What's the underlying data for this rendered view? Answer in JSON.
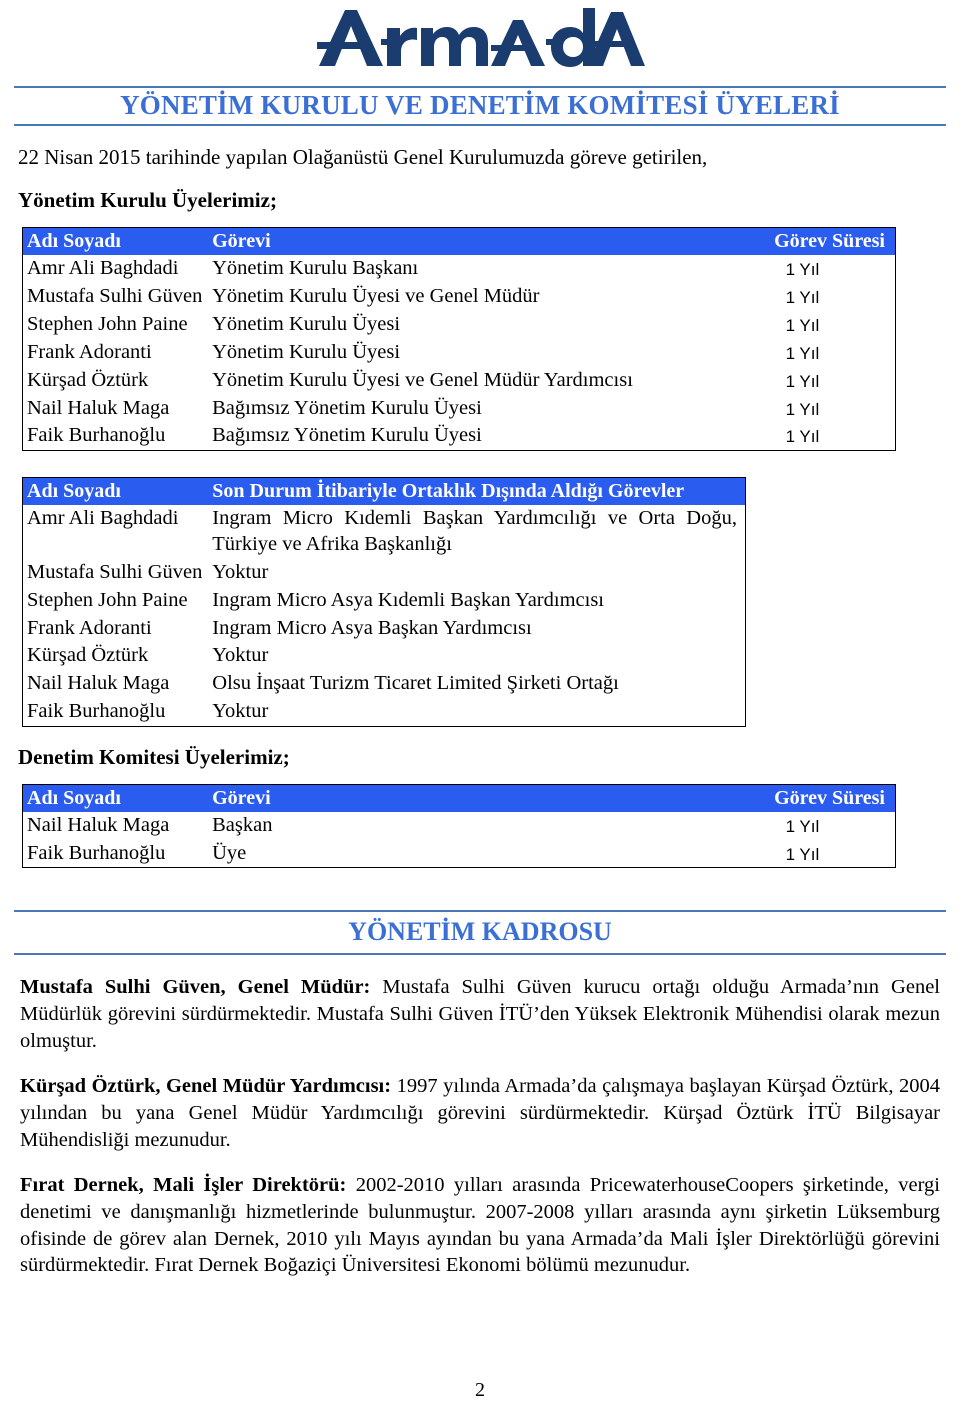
{
  "logo": {
    "text": "ArmAdA",
    "color": "#1b3c6e"
  },
  "header": {
    "title": "YÖNETİM KURULU VE DENETİM KOMİTESİ ÜYELERİ",
    "title_color": "#3b6fd4",
    "rule_color": "#4a77b8"
  },
  "intro": {
    "paragraph": "22 Nisan 2015 tarihinde yapılan Olağanüstü Genel Kurulumuzda göreve getirilen,",
    "board_subhead": "Yönetim Kurulu Üyelerimiz;",
    "audit_subhead": "Denetim Komitesi Üyelerimiz;"
  },
  "board_table": {
    "header_bg": "#2b5cf0",
    "columns": [
      "Adı Soyadı",
      "Görevi",
      "Görev Süresi"
    ],
    "rows": [
      {
        "name": "Amr Ali Baghdadi",
        "role": "Yönetim Kurulu Başkanı",
        "term": "1 Yıl"
      },
      {
        "name": "Mustafa Sulhi Güven",
        "role": "Yönetim Kurulu Üyesi ve Genel Müdür",
        "term": "1 Yıl"
      },
      {
        "name": "Stephen John Paine",
        "role": "Yönetim Kurulu Üyesi",
        "term": "1 Yıl"
      },
      {
        "name": "Frank Adoranti",
        "role": "Yönetim Kurulu Üyesi",
        "term": "1 Yıl"
      },
      {
        "name": "Kürşad Öztürk",
        "role": "Yönetim Kurulu Üyesi ve Genel Müdür Yardımcısı",
        "term": "1 Yıl"
      },
      {
        "name": "Nail Haluk Maga",
        "role": "Bağımsız Yönetim Kurulu Üyesi",
        "term": "1 Yıl"
      },
      {
        "name": "Faik Burhanoğlu",
        "role": "Bağımsız Yönetim Kurulu Üyesi",
        "term": "1 Yıl"
      }
    ]
  },
  "duties_table": {
    "header_bg": "#2b5cf0",
    "columns": [
      "Adı Soyadı",
      "Son Durum İtibariyle Ortaklık Dışında Aldığı Görevler"
    ],
    "rows": [
      {
        "name": "Amr Ali Baghdadi",
        "duty": "Ingram Micro Kıdemli Başkan Yardımcılığı ve Orta Doğu, Türkiye ve Afrika Başkanlığı"
      },
      {
        "name": "Mustafa Sulhi Güven",
        "duty": "Yoktur"
      },
      {
        "name": "Stephen John Paine",
        "duty": "Ingram Micro Asya Kıdemli Başkan Yardımcısı"
      },
      {
        "name": "Frank Adoranti",
        "duty": "Ingram Micro Asya Başkan Yardımcısı"
      },
      {
        "name": "Kürşad Öztürk",
        "duty": "Yoktur"
      },
      {
        "name": "Nail Haluk Maga",
        "duty": "Olsu İnşaat Turizm Ticaret Limited Şirketi Ortağı"
      },
      {
        "name": "Faik Burhanoğlu",
        "duty": "Yoktur"
      }
    ]
  },
  "audit_table": {
    "header_bg": "#2b5cf0",
    "columns": [
      "Adı Soyadı",
      "Görevi",
      "Görev Süresi"
    ],
    "rows": [
      {
        "name": "Nail Haluk Maga",
        "role": "Başkan",
        "term": "1 Yıl"
      },
      {
        "name": "Faik Burhanoğlu",
        "role": "Üye",
        "term": "1 Yıl"
      }
    ]
  },
  "kadro": {
    "title": "YÖNETİM KADROSU",
    "bios": [
      {
        "lead": "Mustafa Sulhi Güven, Genel Müdür:",
        "body": " Mustafa Sulhi Güven kurucu ortağı olduğu Armada’nın Genel Müdürlük görevini sürdürmektedir. Mustafa Sulhi Güven İTÜ’den Yüksek Elektronik Mühendisi olarak mezun olmuştur."
      },
      {
        "lead": "Kürşad Öztürk, Genel Müdür Yardımcısı:",
        "body": " 1997 yılında Armada’da çalışmaya başlayan Kürşad Öztürk,  2004 yılından bu yana Genel Müdür Yardımcılığı görevini sürdürmektedir. Kürşad Öztürk İTÜ Bilgisayar Mühendisliği mezunudur."
      },
      {
        "lead": "Fırat Dernek, Mali İşler Direktörü:",
        "body": " 2002-2010 yılları arasında PricewaterhouseCoopers şirketinde, vergi denetimi ve danışmanlığı hizmetlerinde bulunmuştur. 2007-2008 yılları arasında aynı şirketin Lüksemburg ofisinde de görev alan Dernek, 2010 yılı Mayıs ayından bu yana Armada’da Mali İşler Direktörlüğü görevini sürdürmektedir. Fırat Dernek Boğaziçi Üniversitesi Ekonomi bölümü mezunudur."
      }
    ]
  },
  "footer": {
    "page_number": "2"
  }
}
